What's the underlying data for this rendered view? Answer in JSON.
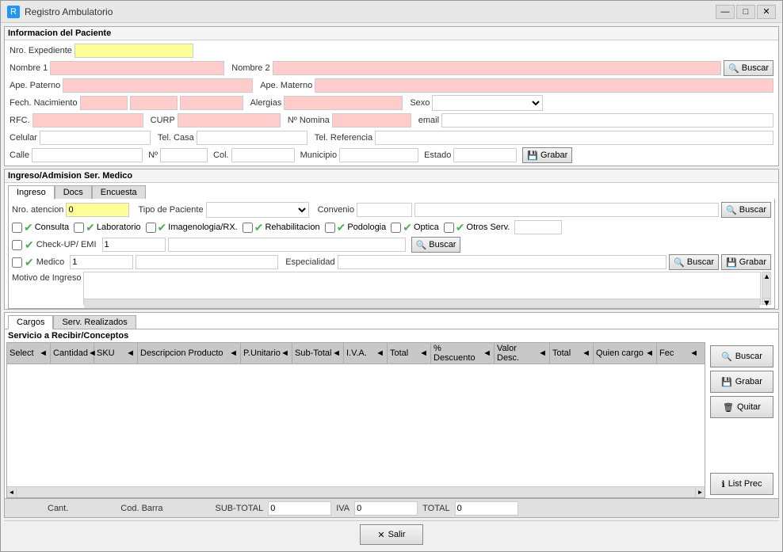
{
  "window": {
    "title": "Registro Ambulatorio",
    "icon": "R",
    "min_btn": "—",
    "max_btn": "□",
    "close_btn": "✕"
  },
  "patient_section": {
    "title": "Informacion del Paciente",
    "fields": {
      "nro_expediente_label": "Nro. Expediente",
      "nombre1_label": "Nombre 1",
      "nombre2_label": "Nombre 2",
      "ape_paterno_label": "Ape. Paterno",
      "ape_materno_label": "Ape. Materno",
      "fech_nacimiento_label": "Fech. Nacimiento",
      "alergias_label": "Alergias",
      "sexo_label": "Sexo",
      "rfc_label": "RFC.",
      "curp_label": "CURP",
      "nomina_label": "Nº Nomina",
      "email_label": "email",
      "celular_label": "Celular",
      "tel_casa_label": "Tel. Casa",
      "tel_referencia_label": "Tel. Referencia",
      "calle_label": "Calle",
      "no_label": "Nº",
      "col_label": "Col.",
      "municipio_label": "Municipio",
      "estado_label": "Estado"
    },
    "buscar_btn": "Buscar",
    "grabar_btn": "Grabar"
  },
  "admission_section": {
    "title": "Ingreso/Admision Ser. Medico",
    "tabs": [
      "Ingreso",
      "Docs",
      "Encuesta"
    ],
    "active_tab": "Ingreso",
    "nro_atencion_label": "Nro. atencion",
    "nro_atencion_value": "0",
    "tipo_paciente_label": "Tipo de Paciente",
    "convenio_label": "Convenio",
    "buscar_btn": "Buscar",
    "services": {
      "consulta": "Consulta",
      "laboratorio": "Laboratorio",
      "imagenologia": "Imagenologia/RX.",
      "rehabilitacion": "Rehabilitacion",
      "podologia": "Podologia",
      "optica": "Optica",
      "otros": "Otros Serv."
    },
    "checkup_label": "Check-UP/ EMI",
    "checkup_value": "1",
    "medico_label": "Medico",
    "medico_value": "1",
    "especialidad_label": "Especialidad",
    "buscar_btn2": "Buscar",
    "grabar_btn2": "Grabar",
    "motivo_label": "Motivo de Ingreso"
  },
  "cargo_tabs": [
    "Cargos",
    "Serv. Realizados"
  ],
  "cargo_active_tab": "Cargos",
  "services_section": {
    "title": "Servicio a Recibir/Conceptos",
    "columns": [
      "Select",
      "Cantidad",
      "SKU",
      "Descripcion Producto",
      "P.Unitario",
      "Sub-Total",
      "I.V.A.",
      "Total",
      "% Descuento",
      "Valor Desc.",
      "Total",
      "Quien cargo",
      "Fec"
    ],
    "buscar_btn": "Buscar",
    "grabar_btn": "Grabar",
    "quitar_btn": "Quitar",
    "list_prec_btn": "List Prec"
  },
  "totals": {
    "cant_label": "Cant.",
    "cod_barra_label": "Cod. Barra",
    "sub_total_label": "SUB-TOTAL",
    "sub_total_value": "0",
    "iva_label": "IVA",
    "iva_value": "0",
    "total_label": "TOTAL",
    "total_value": "0"
  },
  "footer": {
    "salir_btn": "Salir"
  }
}
